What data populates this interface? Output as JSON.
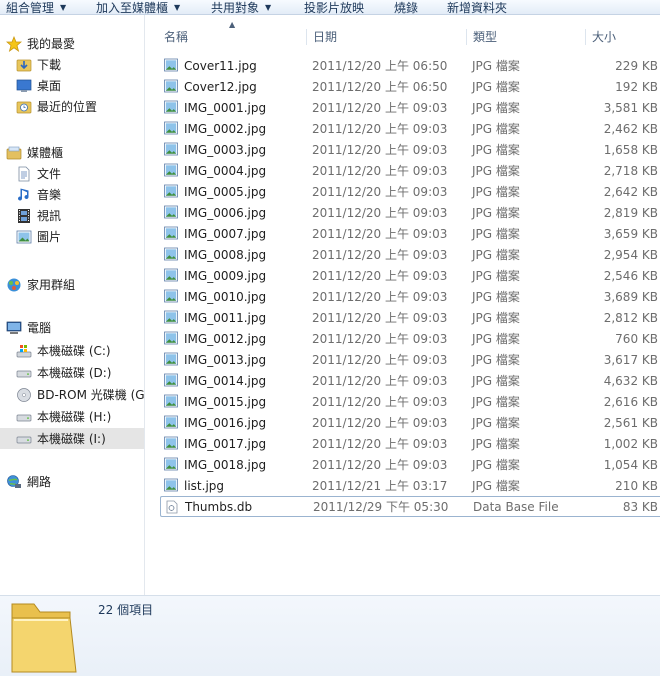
{
  "toolbar": {
    "organize": "組合管理",
    "add_to_library": "加入至媒體櫃",
    "share_with": "共用對象",
    "slideshow": "投影片放映",
    "burn": "燒錄",
    "new_folder": "新增資料夾"
  },
  "nav": {
    "favorites": "我的最愛",
    "downloads": "下載",
    "desktop": "桌面",
    "recent_places": "最近的位置",
    "libraries": "媒體櫃",
    "documents": "文件",
    "music": "音樂",
    "videos": "視訊",
    "pictures": "圖片",
    "homegroup": "家用群組",
    "computer": "電腦",
    "drive_c": "本機磁碟 (C:)",
    "drive_d": "本機磁碟 (D:)",
    "drive_g": "BD-ROM 光碟機 (G",
    "drive_h": "本機磁碟 (H:)",
    "drive_i": "本機磁碟 (I:)",
    "network": "網路"
  },
  "columns": {
    "name": "名稱",
    "date": "日期",
    "type": "類型",
    "size": "大小"
  },
  "files": [
    {
      "name": "Cover11.jpg",
      "date": "2011/12/20 上午 06:50",
      "type": "JPG 檔案",
      "size": "229 KB"
    },
    {
      "name": "Cover12.jpg",
      "date": "2011/12/20 上午 06:50",
      "type": "JPG 檔案",
      "size": "192 KB"
    },
    {
      "name": "IMG_0001.jpg",
      "date": "2011/12/20 上午 09:03",
      "type": "JPG 檔案",
      "size": "3,581 KB"
    },
    {
      "name": "IMG_0002.jpg",
      "date": "2011/12/20 上午 09:03",
      "type": "JPG 檔案",
      "size": "2,462 KB"
    },
    {
      "name": "IMG_0003.jpg",
      "date": "2011/12/20 上午 09:03",
      "type": "JPG 檔案",
      "size": "1,658 KB"
    },
    {
      "name": "IMG_0004.jpg",
      "date": "2011/12/20 上午 09:03",
      "type": "JPG 檔案",
      "size": "2,718 KB"
    },
    {
      "name": "IMG_0005.jpg",
      "date": "2011/12/20 上午 09:03",
      "type": "JPG 檔案",
      "size": "2,642 KB"
    },
    {
      "name": "IMG_0006.jpg",
      "date": "2011/12/20 上午 09:03",
      "type": "JPG 檔案",
      "size": "2,819 KB"
    },
    {
      "name": "IMG_0007.jpg",
      "date": "2011/12/20 上午 09:03",
      "type": "JPG 檔案",
      "size": "3,659 KB"
    },
    {
      "name": "IMG_0008.jpg",
      "date": "2011/12/20 上午 09:03",
      "type": "JPG 檔案",
      "size": "2,954 KB"
    },
    {
      "name": "IMG_0009.jpg",
      "date": "2011/12/20 上午 09:03",
      "type": "JPG 檔案",
      "size": "2,546 KB"
    },
    {
      "name": "IMG_0010.jpg",
      "date": "2011/12/20 上午 09:03",
      "type": "JPG 檔案",
      "size": "3,689 KB"
    },
    {
      "name": "IMG_0011.jpg",
      "date": "2011/12/20 上午 09:03",
      "type": "JPG 檔案",
      "size": "2,812 KB"
    },
    {
      "name": "IMG_0012.jpg",
      "date": "2011/12/20 上午 09:03",
      "type": "JPG 檔案",
      "size": "760 KB"
    },
    {
      "name": "IMG_0013.jpg",
      "date": "2011/12/20 上午 09:03",
      "type": "JPG 檔案",
      "size": "3,617 KB"
    },
    {
      "name": "IMG_0014.jpg",
      "date": "2011/12/20 上午 09:03",
      "type": "JPG 檔案",
      "size": "4,632 KB"
    },
    {
      "name": "IMG_0015.jpg",
      "date": "2011/12/20 上午 09:03",
      "type": "JPG 檔案",
      "size": "2,616 KB"
    },
    {
      "name": "IMG_0016.jpg",
      "date": "2011/12/20 上午 09:03",
      "type": "JPG 檔案",
      "size": "2,561 KB"
    },
    {
      "name": "IMG_0017.jpg",
      "date": "2011/12/20 上午 09:03",
      "type": "JPG 檔案",
      "size": "1,002 KB"
    },
    {
      "name": "IMG_0018.jpg",
      "date": "2011/12/20 上午 09:03",
      "type": "JPG 檔案",
      "size": "1,054 KB"
    },
    {
      "name": "list.jpg",
      "date": "2011/12/21 上午 03:17",
      "type": "JPG 檔案",
      "size": "210 KB"
    },
    {
      "name": "Thumbs.db",
      "date": "2011/12/29 下午 05:30",
      "type": "Data Base File",
      "size": "83 KB"
    }
  ],
  "details": {
    "item_count": "22 個項目"
  }
}
